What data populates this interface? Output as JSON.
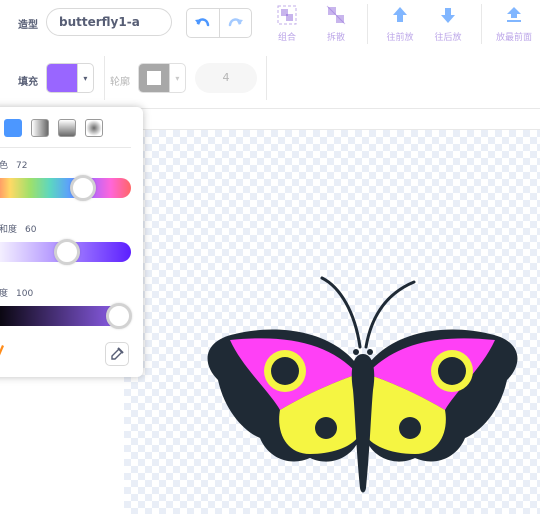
{
  "toolbar": {
    "costume_label": "造型",
    "costume_name": "butterfly1-a",
    "fill_label": "填充",
    "outline_label": "轮廓",
    "outline_width": "4",
    "tools": [
      {
        "label": "组合",
        "icon": "group-icon"
      },
      {
        "label": "拆散",
        "icon": "ungroup-icon"
      },
      {
        "label": "往前放",
        "icon": "forward-icon"
      },
      {
        "label": "往后放",
        "icon": "backward-icon"
      },
      {
        "label": "放最前面",
        "icon": "front-icon"
      }
    ]
  },
  "colors": {
    "fill": "#9966ff",
    "outline": "#a8a8a8",
    "accent": "#4c97ff",
    "wing_pink": "#ff40f6",
    "wing_yellow": "#f5f542",
    "body_dark": "#1f2a35"
  },
  "color_picker": {
    "hue_label": "颜色",
    "hue_value": "72",
    "saturation_label": "饱和度",
    "saturation_value": "60",
    "brightness_label": "亮度",
    "brightness_value": "100",
    "hue": 0.72,
    "saturation": 0.6,
    "brightness": 1.0,
    "fill_modes": [
      "solid-fill-icon",
      "horizontal-gradient-icon",
      "vertical-gradient-icon",
      "radial-gradient-icon"
    ]
  }
}
